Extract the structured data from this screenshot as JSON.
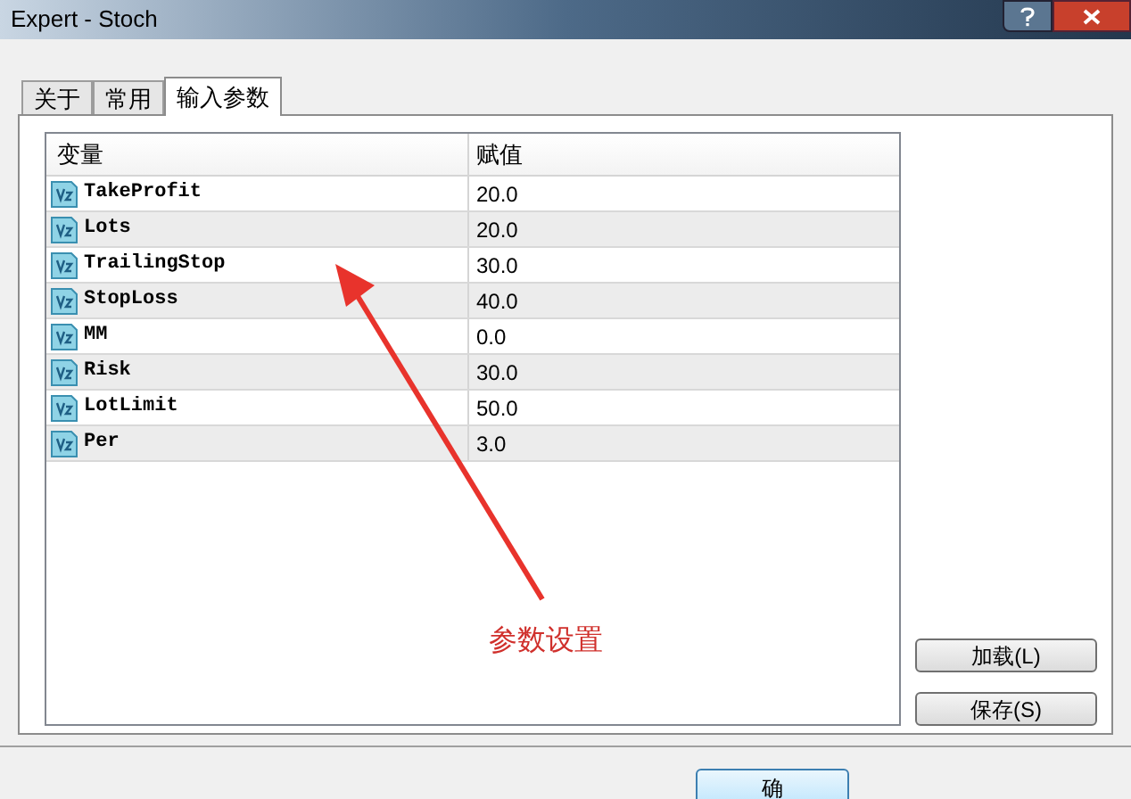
{
  "window": {
    "title": "Expert - Stoch"
  },
  "tabs": [
    {
      "label": "关于",
      "selected": false
    },
    {
      "label": "常用",
      "selected": false
    },
    {
      "label": "输入参数",
      "selected": true
    }
  ],
  "table": {
    "columns": [
      "变量",
      "赋值"
    ],
    "rows": [
      {
        "name": "TakeProfit",
        "value": "20.0"
      },
      {
        "name": "Lots",
        "value": "20.0"
      },
      {
        "name": "TrailingStop",
        "value": "30.0"
      },
      {
        "name": "StopLoss",
        "value": "40.0"
      },
      {
        "name": "MM",
        "value": "0.0"
      },
      {
        "name": "Risk",
        "value": "30.0"
      },
      {
        "name": "LotLimit",
        "value": "50.0"
      },
      {
        "name": "Per",
        "value": "3.0"
      }
    ]
  },
  "annotation": "参数设置",
  "side_buttons": [
    "加载(L)",
    "保存(S)"
  ],
  "footer_buttons": [
    "确"
  ]
}
